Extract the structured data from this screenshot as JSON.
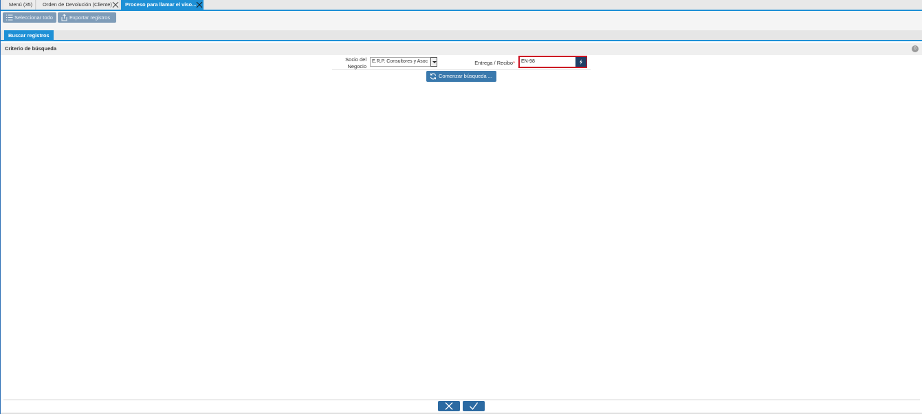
{
  "tabs": [
    {
      "label": "Menú (35)"
    },
    {
      "label": "Orden de Devolución (Cliente)"
    },
    {
      "label": "Proceso para llamar el viso..."
    }
  ],
  "toolbar": {
    "select_all": "Seleccionar todo",
    "export": "Exportar registros"
  },
  "search_tab": "Buscar registros",
  "criteria": {
    "title": "Criterio de búsqueda",
    "badge": "0"
  },
  "form": {
    "bpartner_label": "Socio del Negocio",
    "bpartner_value": "E.R.P. Consultores y Asoc",
    "shipment_label": "Entrega / Recibo",
    "required_mark": "*",
    "shipment_value": "EN-98"
  },
  "search_button": "Comenzar búsqueda ...",
  "colors": {
    "accent": "#1e90d6",
    "button": "#2c6aa2",
    "required_border": "#cc1122"
  }
}
